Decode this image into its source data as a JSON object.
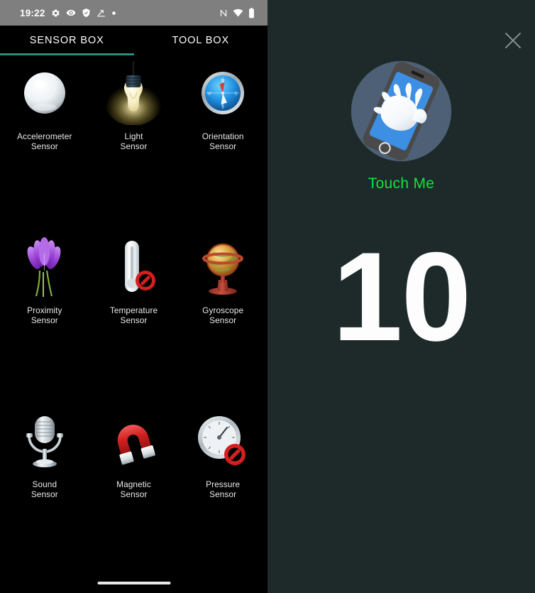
{
  "status_bar": {
    "time": "19:22",
    "left_icons": [
      "gear-icon",
      "eye-icon",
      "shield-icon",
      "trending-up-icon",
      "dot-icon"
    ],
    "right_icons": [
      "nfc-icon",
      "wifi-icon",
      "battery-icon"
    ]
  },
  "tabs": [
    {
      "label": "SENSOR BOX",
      "active": true
    },
    {
      "label": "TOOL BOX",
      "active": false
    }
  ],
  "accent_color": "#2a8b79",
  "sensors": [
    {
      "name_line1": "Accelerometer",
      "name_line2": "Sensor",
      "icon": "sphere-icon",
      "available": true
    },
    {
      "name_line1": "Light",
      "name_line2": "Sensor",
      "icon": "lightbulb-icon",
      "available": true
    },
    {
      "name_line1": "Orientation",
      "name_line2": "Sensor",
      "icon": "compass-icon",
      "available": true
    },
    {
      "name_line1": "Proximity",
      "name_line2": "Sensor",
      "icon": "flower-icon",
      "available": true
    },
    {
      "name_line1": "Temperature",
      "name_line2": "Sensor",
      "icon": "thermometer-icon",
      "available": false
    },
    {
      "name_line1": "Gyroscope",
      "name_line2": "Sensor",
      "icon": "globe-icon",
      "available": true
    },
    {
      "name_line1": "Sound",
      "name_line2": "Sensor",
      "icon": "microphone-icon",
      "available": true
    },
    {
      "name_line1": "Magnetic",
      "name_line2": "Sensor",
      "icon": "magnet-icon",
      "available": true
    },
    {
      "name_line1": "Pressure",
      "name_line2": "Sensor",
      "icon": "gauge-icon",
      "available": false
    }
  ],
  "detail_panel": {
    "background_color": "#1e2a2a",
    "close_icon": "close-icon",
    "hero_icon": "hand-on-phone-icon",
    "title": "Touch Me",
    "title_color": "#13e33c",
    "value": "10",
    "value_color": "#fdfdfd"
  }
}
